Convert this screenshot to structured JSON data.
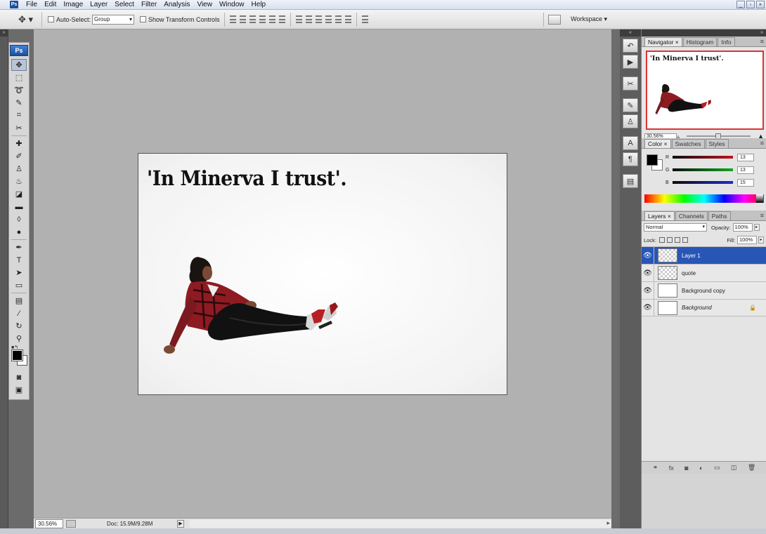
{
  "menubar": {
    "app_badge": "Ps",
    "items": [
      "File",
      "Edit",
      "Image",
      "Layer",
      "Select",
      "Filter",
      "Analysis",
      "View",
      "Window",
      "Help"
    ],
    "win_controls": [
      "_",
      "▫",
      "×"
    ]
  },
  "options": {
    "auto_select_label": "Auto-Select:",
    "auto_select_value": "Group",
    "show_transform_label": "Show Transform Controls",
    "workspace_label": "Workspace ▾"
  },
  "toolbox": {
    "logo": "Ps",
    "tools": [
      "move",
      "marquee",
      "lasso",
      "quick-select",
      "crop",
      "slice",
      "healing",
      "brush",
      "stamp",
      "history",
      "eraser",
      "gradient",
      "blur",
      "dodge",
      "pen",
      "type",
      "path-select",
      "shape",
      "notes",
      "eyedropper",
      "rotate",
      "zoom"
    ]
  },
  "canvas": {
    "quote": "'In Minerva I trust'."
  },
  "status": {
    "zoom": "30.56%",
    "doc": "Doc: 15.9M/9.28M"
  },
  "navigator": {
    "tabs": [
      "Navigator ×",
      "Histogram",
      "Info"
    ],
    "thumb_text": "'In Minerva I trust'.",
    "zoom": "30.56%"
  },
  "color": {
    "tabs": [
      "Color ×",
      "Swatches",
      "Styles"
    ],
    "channels": [
      {
        "label": "R",
        "value": "13",
        "bar": "#c0141e"
      },
      {
        "label": "G",
        "value": "13",
        "bar": "#10a81c"
      },
      {
        "label": "B",
        "value": "15",
        "bar": "#1c2ad0"
      }
    ]
  },
  "layers": {
    "tabs": [
      "Layers ×",
      "Channels",
      "Paths"
    ],
    "blend_mode": "Normal",
    "opacity_label": "Opacity:",
    "opacity": "100%",
    "lock_label": "Lock:",
    "fill_label": "Fill:",
    "fill": "100%",
    "items": [
      {
        "name": "Layer 1",
        "selected": true,
        "thumb": "checker",
        "italic": false,
        "locked": false
      },
      {
        "name": "quote",
        "selected": false,
        "thumb": "checker",
        "italic": false,
        "locked": false
      },
      {
        "name": "Background copy",
        "selected": false,
        "thumb": "white",
        "italic": false,
        "locked": false
      },
      {
        "name": "Background",
        "selected": false,
        "thumb": "white",
        "italic": true,
        "locked": true
      }
    ]
  },
  "colors": {
    "selected_layer": "#2856b6",
    "nav_border": "#dd3333"
  }
}
